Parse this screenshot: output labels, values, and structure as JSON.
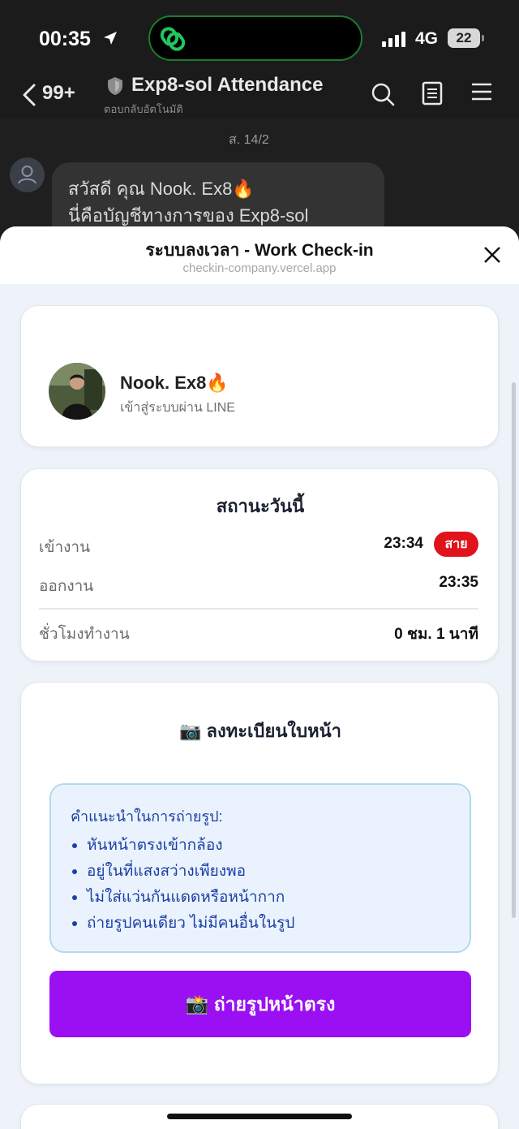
{
  "status_bar": {
    "time": "00:35",
    "network": "4G",
    "battery": "22"
  },
  "chat_header": {
    "unread": "99+",
    "title": "Exp8-sol Attendance",
    "subtitle": "ตอบกลับอัตโนมัติ"
  },
  "chat": {
    "date": "ส. 14/2",
    "message_line1": "สวัสดี คุณ Nook. Ex8🔥",
    "message_line2": "นี่คือบัญชีทางการของ Exp8-sol"
  },
  "sheet": {
    "title": "ระบบลงเวลา - Work Check-in",
    "url": "checkin-company.vercel.app"
  },
  "profile": {
    "name": "Nook. Ex8🔥",
    "login_via": "เข้าสู่ระบบผ่าน LINE"
  },
  "today_status": {
    "title": "สถานะวันนี้",
    "check_in_label": "เข้างาน",
    "check_in_time": "23:34",
    "late_badge": "สาย",
    "check_out_label": "ออกงาน",
    "check_out_time": "23:35",
    "hours_label": "ชั่วโมงทำงาน",
    "hours_value": "0 ชม. 1 นาที"
  },
  "face_register": {
    "title": "📷 ลงทะเบียนใบหน้า",
    "tips_title": "คำแนะนำในการถ่ายรูป:",
    "tips": [
      "หันหน้าตรงเข้ากล้อง",
      "อยู่ในที่แสงสว่างเพียงพอ",
      "ไม่ใส่แว่นกันแดดหรือหน้ากาก",
      "ถ่ายรูปคนเดียว ไม่มีคนอื่นในรูป"
    ],
    "button_label": "📸 ถ่ายรูปหน้าตรง"
  },
  "colors": {
    "accent_purple": "#9b0ff3",
    "late_red": "#e0131c",
    "tip_blue": "#1b3fa6",
    "island_green": "#22c55e"
  }
}
